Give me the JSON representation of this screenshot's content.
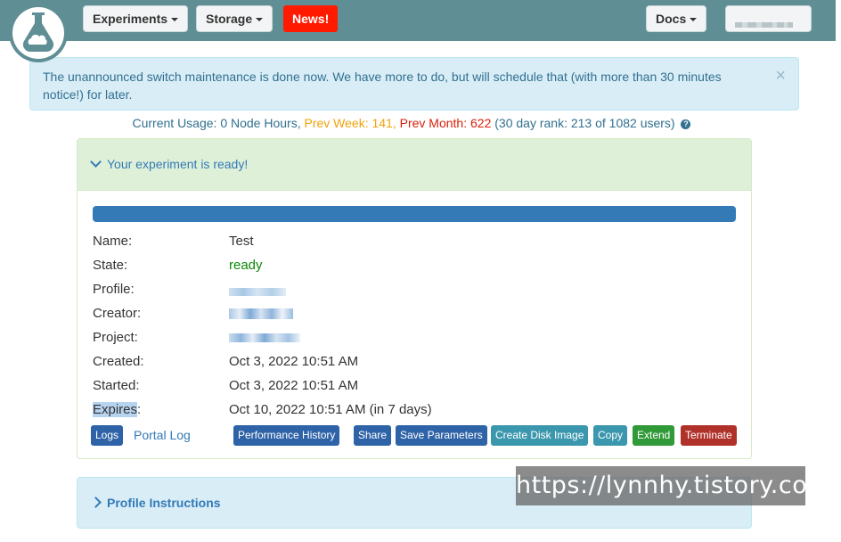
{
  "nav": {
    "experiments": "Experiments",
    "storage": "Storage",
    "news": "News!",
    "docs": "Docs"
  },
  "alert": {
    "text": "The unannounced switch maintenance is done now. We have more to do, but will schedule that (with more than 30 minutes notice!) for later.",
    "close": "×"
  },
  "usage": {
    "current": "Current Usage: 0 Node Hours,",
    "prev_week": "Prev Week: 141,",
    "prev_month": "Prev Month: 622",
    "rank": "(30 day rank: 213 of 1082 users)",
    "help": "?"
  },
  "experiment": {
    "heading": "Your experiment is ready!",
    "progress": 1.0,
    "fields": [
      {
        "label": "Name:",
        "value": "Test"
      },
      {
        "label": "State:",
        "value": "ready"
      },
      {
        "label": "Profile:",
        "value": ""
      },
      {
        "label": "Creator:",
        "value": ""
      },
      {
        "label": "Project:",
        "value": ""
      },
      {
        "label": "Created:",
        "value": "Oct 3, 2022 10:51 AM"
      },
      {
        "label": "Started:",
        "value": "Oct 3, 2022 10:51 AM"
      },
      {
        "label": "Expires",
        "label_suffix": ":",
        "value": "Oct 10, 2022 10:51 AM (in 7 days)"
      }
    ],
    "buttons": {
      "logs": "Logs",
      "portal_log": "Portal Log",
      "performance_history": "Performance History",
      "share": "Share",
      "save_parameters": "Save Parameters",
      "create_disk_image": "Create Disk Image",
      "copy": "Copy",
      "extend": "Extend",
      "terminate": "Terminate"
    }
  },
  "profile_instructions": "Profile Instructions",
  "watermark": "https://lynnhy.tistory.com",
  "colors": {
    "navbar": "#5f8f95",
    "news": "#ff1a00",
    "ready": "#0a8a0a",
    "progress": "#337ab7"
  }
}
